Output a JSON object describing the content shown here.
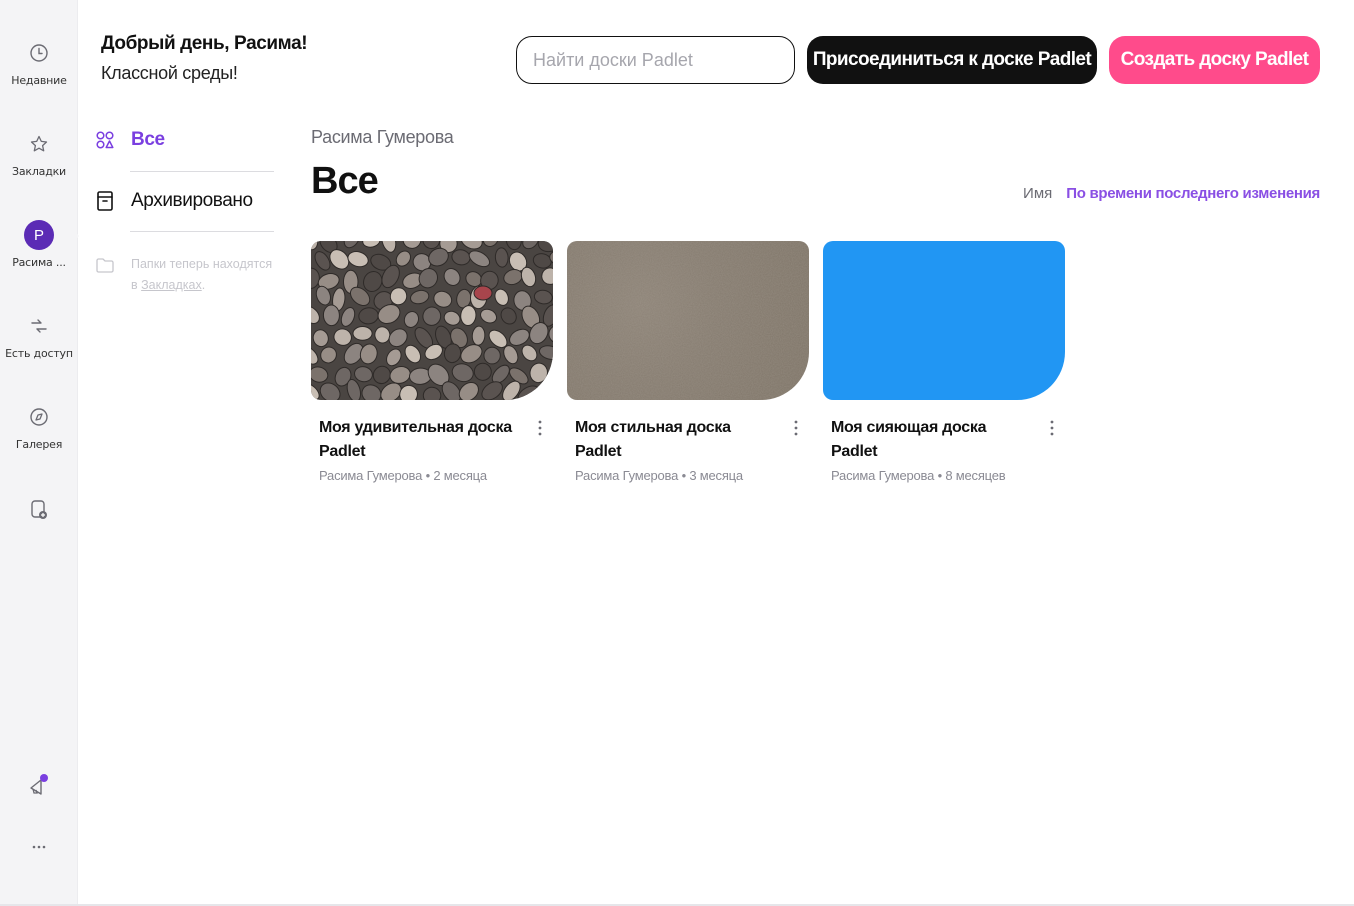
{
  "rail": {
    "items": [
      {
        "label": "Недавние",
        "icon": "clock-icon"
      },
      {
        "label": "Закладки",
        "icon": "star-icon"
      },
      {
        "label": "Расима ...",
        "icon": "avatar",
        "avatar_letter": "P"
      },
      {
        "label": "Есть доступ",
        "icon": "handshake-icon"
      },
      {
        "label": "Галерея",
        "icon": "compass-icon"
      },
      {
        "label": "",
        "icon": "new-document-icon"
      }
    ],
    "bottom": {
      "announcement_icon": "megaphone-icon",
      "more_icon": "more-icon"
    }
  },
  "header": {
    "greeting": "Добрый день, Расима!",
    "subtitle": "Классной среды!",
    "search_placeholder": "Найти доски Padlet",
    "join_label": "Присоединиться к доске Padlet",
    "create_label": "Создать доску Padlet"
  },
  "folders": {
    "all_label": "Все",
    "archived_label": "Архивировано",
    "note_text": "Папки теперь находятся в ",
    "note_link": "Закладках",
    "note_end": "."
  },
  "main": {
    "owner": "Расима Гумерова",
    "title": "Все",
    "sort_name": "Имя",
    "sort_modified": "По времени последнего изменения",
    "active_sort": "По времени последнего изменения"
  },
  "cards": [
    {
      "title": "Моя удивительная доска Padlet",
      "meta": "Расима Гумерова • 2 месяца",
      "thumbnail": "pebbles"
    },
    {
      "title": "Моя стильная доска Padlet",
      "meta": "Расима Гумерова • 3 месяца",
      "thumbnail": "taupe texture"
    },
    {
      "title": "Моя сияющая доска Padlet",
      "meta": "Расима Гумерова • 8 месяцев",
      "thumbnail": "solid blue"
    }
  ],
  "colors": {
    "accent_purple": "#7a3fe0",
    "create_pink": "#ff4b8b",
    "join_black": "#111111",
    "avatar_purple": "#5b2bb5",
    "card3_blue": "#2196f3",
    "card2_taupe": "#8a7f72"
  }
}
